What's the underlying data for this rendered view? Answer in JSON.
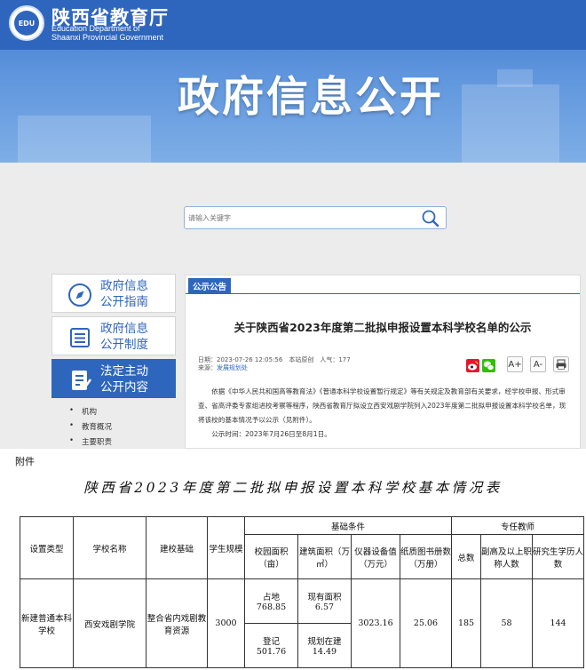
{
  "header": {
    "site_name_cn": "陕西省教育厅",
    "site_name_en_1": "Education Department of",
    "site_name_en_2": "Shaanxi Provincial Government",
    "emblem_text": "EDU",
    "banner_title": "政府信息公开"
  },
  "search": {
    "placeholder": "请输入关键字",
    "button_icon": "search-icon"
  },
  "sidebar": {
    "items": [
      {
        "label_line1": "政府信息",
        "label_line2": "公开指南",
        "icon": "compass-icon"
      },
      {
        "label_line1": "政府信息",
        "label_line2": "公开制度",
        "icon": "list-icon"
      },
      {
        "label_line1": "法定主动",
        "label_line2": "公开内容",
        "icon": "edit-document-icon"
      }
    ],
    "subitems": [
      "机构",
      "教育概况",
      "主要职责"
    ]
  },
  "notice": {
    "section_tag": "公示公告",
    "title": "关于陕西省2023年度第二批拟申报设置本科学校名单的公示",
    "meta_line1": "日期：2023-07-26 12:05:56　本站原创　人气：177",
    "source_label": "来源：",
    "source_value": "发展规划处",
    "tools": {
      "weibo": "weibo-share-icon",
      "wechat": "wechat-share-icon",
      "font_larger": "A+",
      "font_smaller": "A-",
      "print": "print-icon"
    },
    "paragraph1": "依据《中华人民共和国高等教育法》《普通本科学校设置暂行规定》等有关规定及教育部有关要求，经学校申报、形式审查、省高评委专家组进校考察等程序，陕西省教育厅拟设立西安戏剧学院列入2023年度第二批拟申报设置本科学校名单，现将该校的基本情况予以公示（见附件）。",
    "paragraph2": "公示时间：2023年7月26日至8月1日。"
  },
  "attachment": {
    "label": "附件",
    "title": "陕西省2023年度第二批拟申报设置本科学校基本情况表",
    "table": {
      "headers": {
        "type": "设置类型",
        "name": "学校名称",
        "basis": "建校基础",
        "students": "学生规模",
        "basic_conditions": "基础条件",
        "campus_area": "校园面积（亩）",
        "building_area": "建筑面积（万㎡）",
        "equipment_value": "仪器设备值（万元）",
        "books": "纸质图书册数（万册）",
        "teachers": "专任教师",
        "total": "总数",
        "senior_titles": "副高及以上职称人数",
        "postgraduate": "研究生学历人数"
      },
      "row": {
        "type": "新建普通本科学校",
        "name": "西安戏剧学院",
        "basis": "整合省内戏剧教育资源",
        "students": "3000",
        "campus_land_label": "占地",
        "campus_land_value": "768.85",
        "campus_reg_label": "登记",
        "campus_reg_value": "501.76",
        "building_existing_label": "现有面积",
        "building_existing_value": "6.57",
        "building_planned_label": "规划在建",
        "building_planned_value": "14.49",
        "equipment_value": "3023.16",
        "books": "25.06",
        "teachers_total": "185",
        "senior_titles": "58",
        "postgraduate": "144"
      }
    }
  }
}
